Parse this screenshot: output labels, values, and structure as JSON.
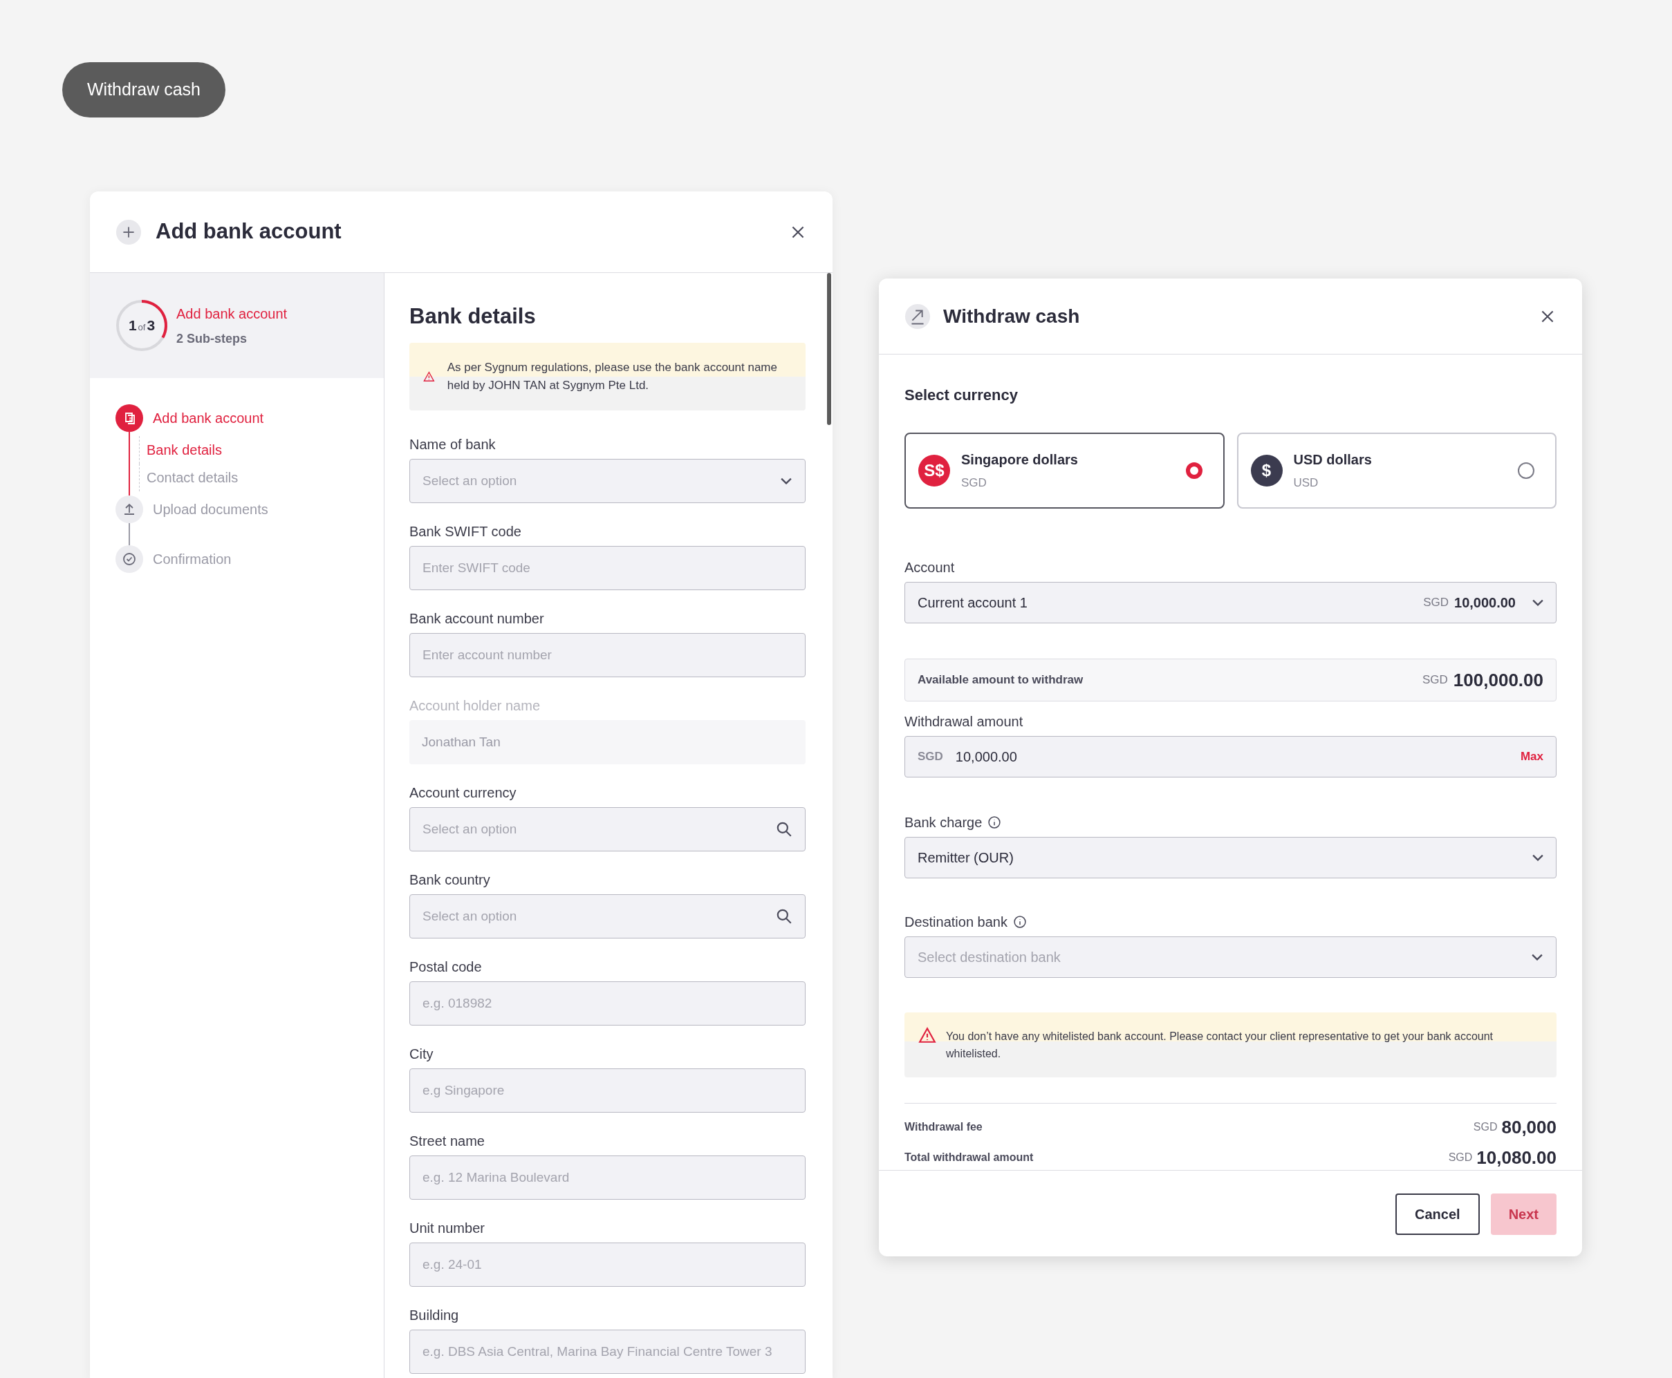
{
  "top_button": {
    "label": "Withdraw cash"
  },
  "add_bank_modal": {
    "title": "Add bank account",
    "progress": {
      "current": "1",
      "of": "of",
      "total": "3",
      "title": "Add bank account",
      "subtitle": "2 Sub-steps"
    },
    "steps": [
      {
        "label": "Add bank account",
        "kind": "document",
        "active": true,
        "children": [
          {
            "label": "Bank details",
            "selected": true
          },
          {
            "label": "Contact details",
            "selected": false
          }
        ]
      },
      {
        "label": "Upload documents",
        "kind": "upload",
        "active": false
      },
      {
        "label": "Confirmation",
        "kind": "check",
        "active": false
      }
    ],
    "form": {
      "title": "Bank details",
      "alert": "As per Sygnum regulations, please use the bank account name held by JOHN TAN at Sygnym Pte Ltd.",
      "fields": [
        {
          "label": "Name of bank",
          "kind": "select",
          "placeholder": "Select an option",
          "disabled": false
        },
        {
          "label": "Bank SWIFT code",
          "kind": "text",
          "placeholder": "Enter SWIFT code",
          "disabled": false
        },
        {
          "label": "Bank account number",
          "kind": "text",
          "placeholder": "Enter account number",
          "disabled": false
        },
        {
          "label": "Account holder name",
          "kind": "text",
          "value": "Jonathan Tan",
          "disabled": true
        },
        {
          "label": "Account currency",
          "kind": "search",
          "placeholder": "Select an option",
          "disabled": false
        },
        {
          "label": "Bank country",
          "kind": "search",
          "placeholder": "Select an option",
          "disabled": false
        },
        {
          "label": "Postal code",
          "kind": "text",
          "placeholder": "e.g. 018982",
          "disabled": false
        },
        {
          "label": "City",
          "kind": "text",
          "placeholder": "e.g Singapore",
          "disabled": false
        },
        {
          "label": "Street name",
          "kind": "text",
          "placeholder": "e.g. 12 Marina Boulevard",
          "disabled": false
        },
        {
          "label": "Unit number",
          "kind": "text",
          "placeholder": "e.g. 24-01",
          "disabled": false
        },
        {
          "label": "Building",
          "kind": "text",
          "placeholder": "e.g. DBS Asia Central, Marina Bay Financial Centre Tower 3",
          "disabled": false
        }
      ]
    }
  },
  "withdraw_modal": {
    "title": "Withdraw cash",
    "section": "Select currency",
    "currencies": [
      {
        "symbol": "S$",
        "name": "Singapore dollars",
        "code": "SGD",
        "color": "#e0213f",
        "selected": true
      },
      {
        "symbol": "$",
        "name": "USD dollars",
        "code": "USD",
        "color": "#3b3b4f",
        "selected": false
      }
    ],
    "account": {
      "label": "Account",
      "value": "Current account 1",
      "currency": "SGD",
      "amount": "10,000.00"
    },
    "available": {
      "label": "Available amount to withdraw",
      "currency": "SGD",
      "amount": "100,000.00"
    },
    "withdrawal_amount": {
      "label": "Withdrawal amount",
      "currency": "SGD",
      "value": "10,000.00",
      "max": "Max"
    },
    "bank_charge": {
      "label": "Bank charge",
      "value": "Remitter (OUR)"
    },
    "destination_bank": {
      "label": "Destination bank",
      "placeholder": "Select destination bank"
    },
    "alert": "You don’t have any whitelisted bank account. Please contact your client representative to get your bank account whitelisted.",
    "summary": [
      {
        "label": "Withdrawal fee",
        "currency": "SGD",
        "amount": "80,000"
      },
      {
        "label": "Total withdrawal amount",
        "currency": "SGD",
        "amount": "10,080.00"
      }
    ],
    "buttons": [
      {
        "label": "Cancel",
        "kind": "secondary",
        "disabled": false
      },
      {
        "label": "Next",
        "kind": "primary",
        "disabled": true
      }
    ]
  }
}
